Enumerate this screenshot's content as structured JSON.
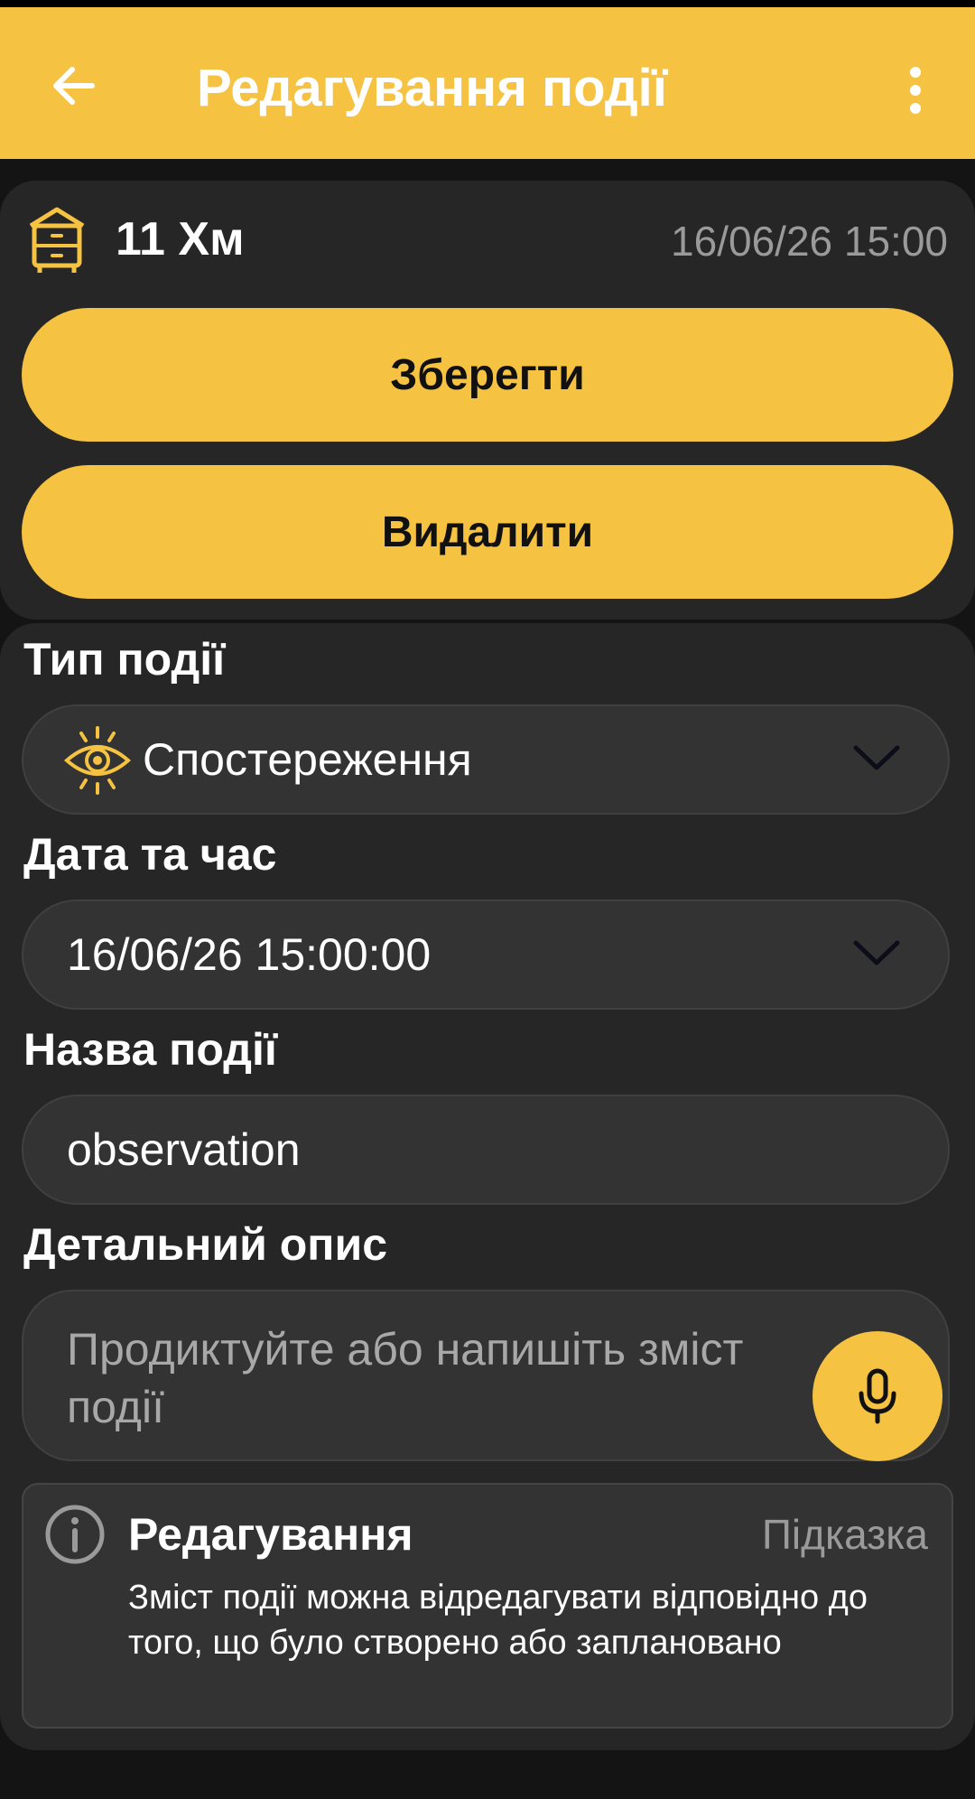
{
  "appbar": {
    "title": "Редагування події",
    "icons": {
      "back": "arrow-left-icon",
      "more": "more-vertical-icon"
    }
  },
  "hive": {
    "name": "11 Хм",
    "datetime": "16/06/26 15:00",
    "icon": "beehive-icon"
  },
  "actions": {
    "save_label": "Зберегти",
    "delete_label": "Видалити"
  },
  "form": {
    "event_type": {
      "label": "Тип події",
      "value": "Спостереження",
      "icon": "eye-icon"
    },
    "datetime": {
      "label": "Дата та час",
      "value": "16/06/26 15:00:00"
    },
    "event_name": {
      "label": "Назва події",
      "value": "observation"
    },
    "description": {
      "label": "Детальний опис",
      "placeholder": "Продиктуйте або напишіть зміст події",
      "mic_icon": "microphone-icon"
    }
  },
  "hint": {
    "title": "Редагування",
    "link": "Підказка",
    "body": "Зміст події можна відредагувати відповідно до того, що було створено або заплановано",
    "icon": "info-icon"
  },
  "colors": {
    "accent": "#F5C242",
    "background": "#141414",
    "card": "#262626",
    "field": "#333333",
    "muted_text": "#9A9A9A"
  }
}
